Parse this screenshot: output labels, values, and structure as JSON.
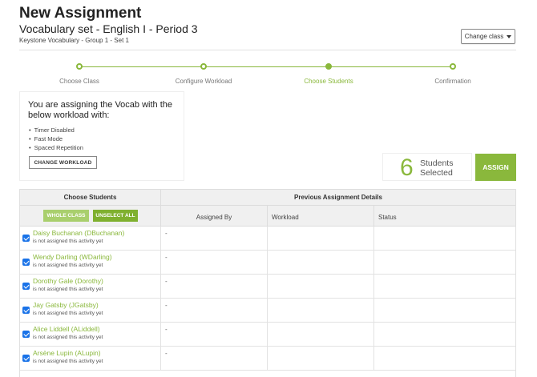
{
  "header": {
    "title": "New Assignment",
    "subtitle": "Vocabulary set - English I - Period 3",
    "set_name": "Keystone Vocabulary - Group 1 - Set 1",
    "change_class_label": "Change class"
  },
  "stepper": {
    "steps": [
      {
        "label": "Choose Class",
        "state": "done"
      },
      {
        "label": "Configure Workload",
        "state": "done"
      },
      {
        "label": "Choose Students",
        "state": "active"
      },
      {
        "label": "Confirmation",
        "state": "todo"
      }
    ]
  },
  "workload": {
    "heading": "You are assigning the Vocab with the below workload with:",
    "items": [
      "Timer Disabled",
      "Fast Mode",
      "Spaced Repetition"
    ],
    "change_button": "CHANGE WORKLOAD"
  },
  "selection": {
    "count": "6",
    "label_line1": "Students",
    "label_line2": "Selected",
    "assign_button": "ASSIGN"
  },
  "table": {
    "choose_header": "Choose Students",
    "details_header": "Previous Assignment Details",
    "whole_class_button": "WHOLE CLASS",
    "unselect_all_button": "UNSELECT ALL",
    "columns": [
      "Assigned By",
      "Workload",
      "Status"
    ],
    "rows": [
      {
        "name": "Daisy Buchanan (DBuchanan)",
        "note": "is not assigned this activity yet",
        "assigned_by": "-",
        "workload": "",
        "status": "",
        "checked": true
      },
      {
        "name": "Wendy Darling (WDarling)",
        "note": "is not assigned this activity yet",
        "assigned_by": "-",
        "workload": "",
        "status": "",
        "checked": true
      },
      {
        "name": "Dorothy Gale (Dorothy)",
        "note": "is not assigned this activity yet",
        "assigned_by": "-",
        "workload": "",
        "status": "",
        "checked": true
      },
      {
        "name": "Jay Gatsby (JGatsby)",
        "note": "is not assigned this activity yet",
        "assigned_by": "-",
        "workload": "",
        "status": "",
        "checked": true
      },
      {
        "name": "Alice Liddell (ALiddell)",
        "note": "is not assigned this activity yet",
        "assigned_by": "-",
        "workload": "",
        "status": "",
        "checked": true
      },
      {
        "name": "Arsène Lupin (ALupin)",
        "note": "is not assigned this activity yet",
        "assigned_by": "-",
        "workload": "",
        "status": "",
        "checked": true
      }
    ]
  },
  "colors": {
    "accent": "#8ab83c",
    "checkbox": "#1a73e8"
  }
}
